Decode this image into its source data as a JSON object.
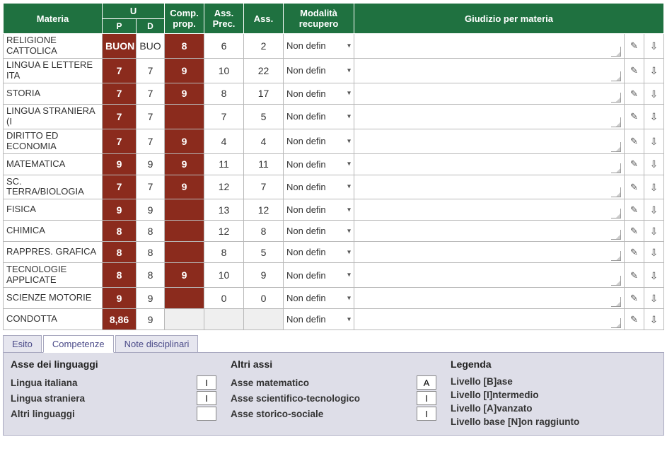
{
  "headers": {
    "materia": "Materia",
    "u": "U",
    "p": "P",
    "d": "D",
    "comp": "Comp. prop.",
    "assprec": "Ass. Prec.",
    "ass": "Ass.",
    "modalita": "Modalità recupero",
    "giudizio": "Giudizio per materia"
  },
  "rows": [
    {
      "subj": "RELIGIONE CATTOLICA",
      "p": "BUON",
      "d": "BUO",
      "comp": "8",
      "assprec": "6",
      "ass": "2",
      "mod": "Non defin"
    },
    {
      "subj": "LINGUA E LETTERE ITA",
      "p": "7",
      "d": "7",
      "comp": "9",
      "assprec": "10",
      "ass": "22",
      "mod": "Non defin"
    },
    {
      "subj": "STORIA",
      "p": "7",
      "d": "7",
      "comp": "9",
      "assprec": "8",
      "ass": "17",
      "mod": "Non defin"
    },
    {
      "subj": "LINGUA STRANIERA (I",
      "p": "7",
      "d": "7",
      "comp": "",
      "assprec": "7",
      "ass": "5",
      "mod": "Non defin"
    },
    {
      "subj": "DIRITTO ED ECONOMIA",
      "p": "7",
      "d": "7",
      "comp": "9",
      "assprec": "4",
      "ass": "4",
      "mod": "Non defin"
    },
    {
      "subj": "MATEMATICA",
      "p": "9",
      "d": "9",
      "comp": "9",
      "assprec": "11",
      "ass": "11",
      "mod": "Non defin"
    },
    {
      "subj": "SC. TERRA/BIOLOGIA",
      "p": "7",
      "d": "7",
      "comp": "9",
      "assprec": "12",
      "ass": "7",
      "mod": "Non defin"
    },
    {
      "subj": "FISICA",
      "p": "9",
      "d": "9",
      "comp": "",
      "assprec": "13",
      "ass": "12",
      "mod": "Non defin"
    },
    {
      "subj": "CHIMICA",
      "p": "8",
      "d": "8",
      "comp": "",
      "assprec": "12",
      "ass": "8",
      "mod": "Non defin"
    },
    {
      "subj": "RAPPRES. GRAFICA",
      "p": "8",
      "d": "8",
      "comp": "",
      "assprec": "8",
      "ass": "5",
      "mod": "Non defin"
    },
    {
      "subj": "TECNOLOGIE APPLICATE",
      "p": "8",
      "d": "8",
      "comp": "9",
      "assprec": "10",
      "ass": "9",
      "mod": "Non defin"
    },
    {
      "subj": "SCIENZE MOTORIE",
      "p": "9",
      "d": "9",
      "comp": "",
      "assprec": "0",
      "ass": "0",
      "mod": "Non defin"
    },
    {
      "subj": "CONDOTTA",
      "p": "8,86",
      "d": "9",
      "comp": "",
      "assprec": "",
      "ass": "",
      "mod": "Non defin",
      "greyTail": true
    }
  ],
  "tabs": {
    "esito": "Esito",
    "competenze": "Competenze",
    "note": "Note disciplinari"
  },
  "panel": {
    "col1": {
      "title": "Asse dei linguaggi",
      "items": [
        {
          "label": "Lingua italiana",
          "val": "I"
        },
        {
          "label": "Lingua straniera",
          "val": "I"
        },
        {
          "label": "Altri linguaggi",
          "val": ""
        }
      ]
    },
    "col2": {
      "title": "Altri assi",
      "items": [
        {
          "label": "Asse matematico",
          "val": "A"
        },
        {
          "label": "Asse scientifico-tecnologico",
          "val": "I"
        },
        {
          "label": "Asse storico-sociale",
          "val": "I"
        }
      ]
    },
    "col3": {
      "title": "Legenda",
      "lines": [
        "Livello [B]ase",
        "Livello [I]ntermedio",
        "Livello [A]vanzato",
        "Livello base [N]on raggiunto"
      ]
    }
  }
}
